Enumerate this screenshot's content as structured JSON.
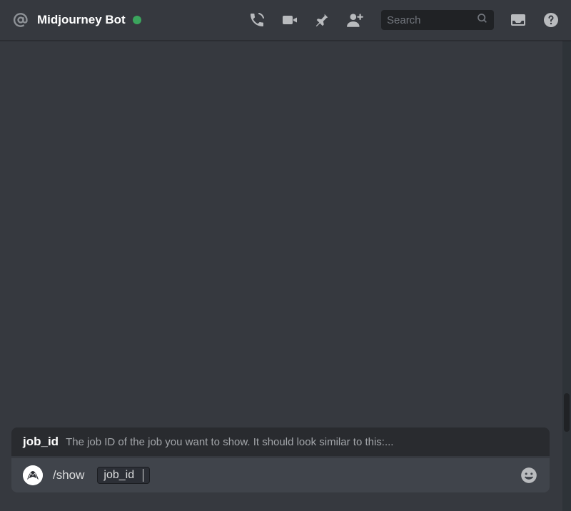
{
  "header": {
    "title": "Midjourney Bot",
    "status": "online"
  },
  "search": {
    "placeholder": "Search"
  },
  "hint": {
    "label": "job_id",
    "description": "The job ID of the job you want to show. It should look similar to this:..."
  },
  "input": {
    "command": "/show",
    "param_label": "job_id"
  },
  "icons": {
    "at": "at-icon",
    "call": "call-icon",
    "video": "video-icon",
    "pin": "pin-icon",
    "add_friend": "add-friend-icon",
    "search": "search-icon",
    "inbox": "inbox-icon",
    "help": "help-icon",
    "emoji": "emoji-icon"
  }
}
